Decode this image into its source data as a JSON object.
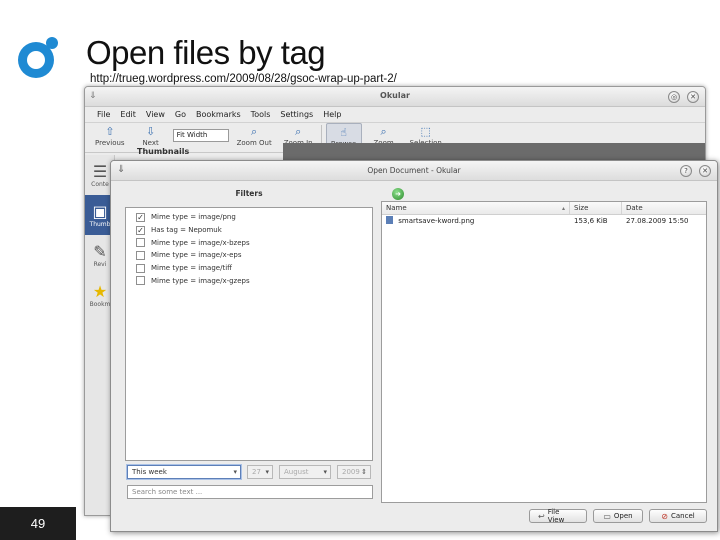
{
  "slide": {
    "title": "Open files by tag",
    "url": "http://trueg.wordpress.com/2009/08/28/gsoc-wrap-up-part-2/",
    "page_number": "49"
  },
  "okular": {
    "title": "Okular",
    "menu": [
      "File",
      "Edit",
      "View",
      "Go",
      "Bookmarks",
      "Tools",
      "Settings",
      "Help"
    ],
    "toolbar": {
      "previous": "Previous",
      "next": "Next",
      "zoom_combo": "Fit Width",
      "zoom_out": "Zoom Out",
      "zoom_in": "Zoom In",
      "browse": "Browse",
      "zoom": "Zoom",
      "selection": "Selection"
    },
    "sidebar": {
      "contents": "Conte",
      "thumbnails": "Thumb",
      "reviews": "Revi",
      "bookmarks": "Bookm"
    },
    "thumbnails_header": "Thumbnails"
  },
  "dialog": {
    "title": "Open Document - Okular",
    "filters_label": "Filters",
    "filters": [
      {
        "label": "Mime type = image/png",
        "checked": true
      },
      {
        "label": "Has tag = Nepomuk",
        "checked": true
      },
      {
        "label": "Mime type = image/x-bzeps",
        "checked": false
      },
      {
        "label": "Mime type = image/x-eps",
        "checked": false
      },
      {
        "label": "Mime type = image/tiff",
        "checked": false
      },
      {
        "label": "Mime type = image/x-gzeps",
        "checked": false
      }
    ],
    "period_combo": "This week",
    "day_combo": "27",
    "month_combo": "August",
    "year_combo": "2009",
    "search_placeholder": "Search some text ...",
    "columns": {
      "name": "Name",
      "size": "Size",
      "date": "Date"
    },
    "files": [
      {
        "name": "smartsave-kword.png",
        "size": "153,6 KiB",
        "date": "27.08.2009 15:50"
      }
    ],
    "buttons": {
      "file_view": "File View",
      "open": "Open",
      "cancel": "Cancel"
    }
  },
  "colors": {
    "logo_blue": "#1f8ad3",
    "sidebar_selected": "#3a5c96",
    "page_num_bg": "#1e1e1e"
  }
}
